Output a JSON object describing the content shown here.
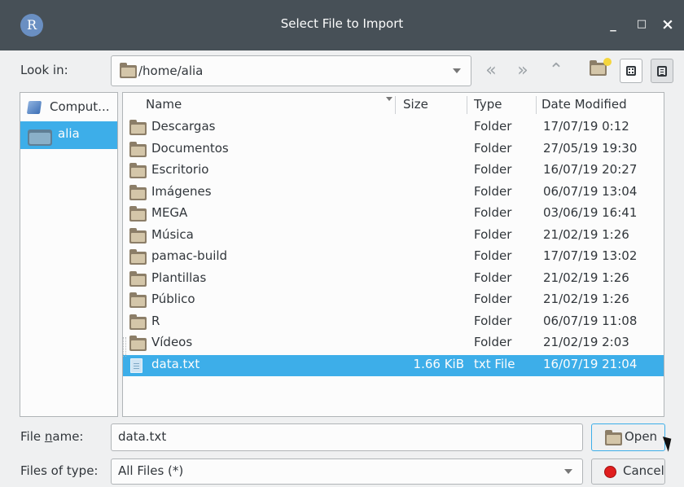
{
  "window": {
    "title": "Select File to Import",
    "app_icon_letter": "R",
    "controls": {
      "minimize": "_",
      "maximize": "□",
      "close": "×"
    }
  },
  "toolbar": {
    "look_in_label": "Look in:",
    "path": "/home/alia",
    "icons": [
      "back-icon",
      "forward-icon",
      "parent-folder-icon",
      "new-folder-icon",
      "icon-view-icon",
      "detail-view-icon"
    ]
  },
  "sidebar": {
    "items": [
      {
        "label": "Comput...",
        "icon": "computer-icon",
        "selected": false
      },
      {
        "label": "alia",
        "icon": "folder-icon",
        "selected": true
      }
    ]
  },
  "columns": {
    "name": "Name",
    "size": "Size",
    "type": "Type",
    "date": "Date Modified"
  },
  "files": [
    {
      "name": "Descargas",
      "size": "",
      "type": "Folder",
      "date": "17/07/19 0:12"
    },
    {
      "name": "Documentos",
      "size": "",
      "type": "Folder",
      "date": "27/05/19 19:30"
    },
    {
      "name": "Escritorio",
      "size": "",
      "type": "Folder",
      "date": "16/07/19 20:27"
    },
    {
      "name": "Imágenes",
      "size": "",
      "type": "Folder",
      "date": "06/07/19 13:04"
    },
    {
      "name": "MEGA",
      "size": "",
      "type": "Folder",
      "date": "03/06/19 16:41"
    },
    {
      "name": "Música",
      "size": "",
      "type": "Folder",
      "date": "21/02/19 1:26"
    },
    {
      "name": "pamac-build",
      "size": "",
      "type": "Folder",
      "date": "17/07/19 13:02"
    },
    {
      "name": "Plantillas",
      "size": "",
      "type": "Folder",
      "date": "21/02/19 1:26"
    },
    {
      "name": "Público",
      "size": "",
      "type": "Folder",
      "date": "21/02/19 1:26"
    },
    {
      "name": "R",
      "size": "",
      "type": "Folder",
      "date": "06/07/19 11:08"
    },
    {
      "name": "Vídeos",
      "size": "",
      "type": "Folder",
      "date": "21/02/19 2:03"
    },
    {
      "name": "data.txt",
      "size": "1.66 KiB",
      "type": "txt File",
      "date": "16/07/19 21:04",
      "selected": true
    }
  ],
  "file_name": {
    "label_pre": "File ",
    "label_underline": "n",
    "label_post": "ame:",
    "value": "data.txt"
  },
  "file_type": {
    "label": "Files of type:",
    "value": "All Files (*)"
  },
  "buttons": {
    "open": "Open",
    "cancel": "Cancel"
  },
  "colors": {
    "selection": "#3daee9",
    "titlebar": "#475057",
    "background": "#eff0f1"
  }
}
